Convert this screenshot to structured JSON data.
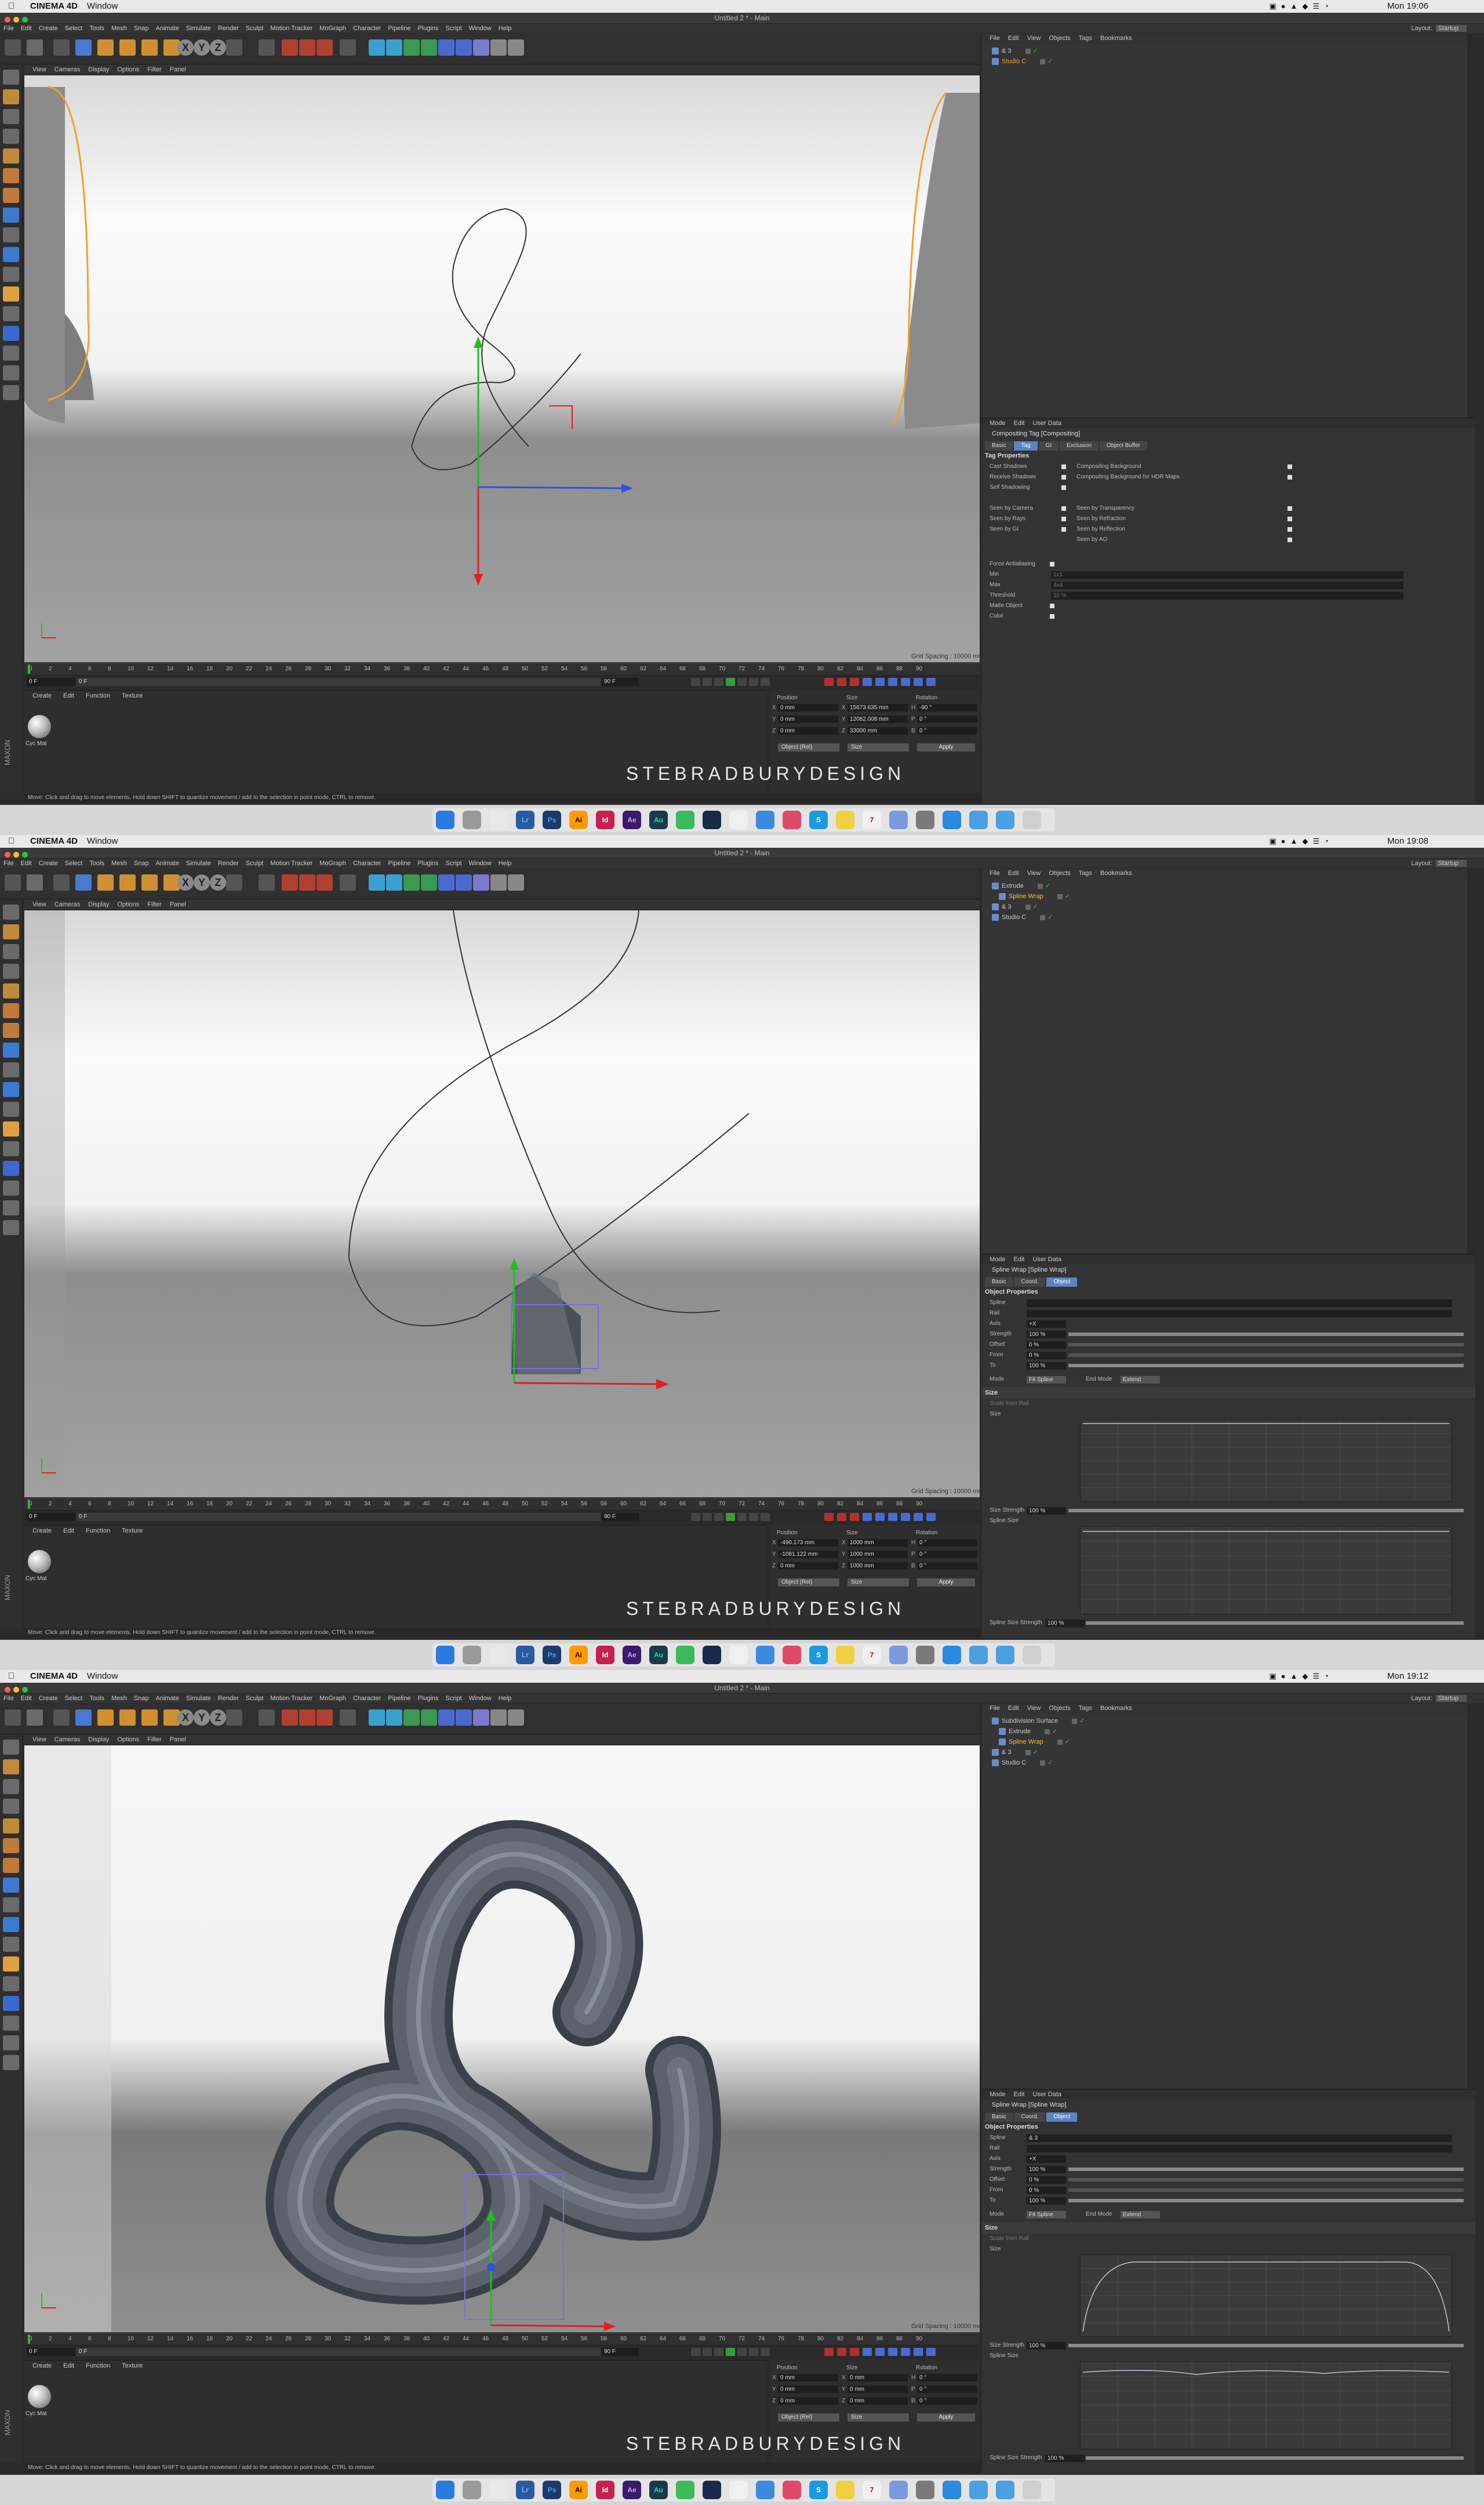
{
  "app": {
    "mac_app_name": "CINEMA 4D",
    "mac_window_menu": "Window",
    "window_title": "Untitled 2 * - Main",
    "watermark": "STEBRADBURYDESIGN",
    "maxon_logo": "MAXON",
    "layout_label": "Layout:",
    "layout_value": "Startup",
    "menu": [
      "File",
      "Edit",
      "Create",
      "Select",
      "Tools",
      "Mesh",
      "Snap",
      "Animate",
      "Simulate",
      "Render",
      "Sculpt",
      "Motion Tracker",
      "MoGraph",
      "Character",
      "Pipeline",
      "Plugins",
      "Script",
      "Window",
      "Help"
    ],
    "viewport_menu": [
      "View",
      "Cameras",
      "Display",
      "Options",
      "Filter",
      "Panel"
    ],
    "object_menu": [
      "File",
      "Edit",
      "View",
      "Objects",
      "Tags",
      "Bookmarks"
    ],
    "attr_menu": [
      "Mode",
      "Edit",
      "User Data"
    ],
    "material_menu": [
      "Create",
      "Edit",
      "Function",
      "Texture"
    ],
    "material_name": "Cyc Mat",
    "coord_headers": {
      "position": "Position",
      "size": "Size",
      "rotation": "Rotation"
    },
    "coord_axis_labels": [
      "X",
      "Y",
      "Z"
    ],
    "rot_labels": [
      "H",
      "P",
      "B"
    ],
    "coord_object_mode": "Object (Rel)",
    "coord_size_mode": "Size",
    "apply_label": "Apply",
    "ruler_ticks": [
      "0",
      "2",
      "4",
      "6",
      "8",
      "10",
      "12",
      "14",
      "16",
      "18",
      "20",
      "22",
      "24",
      "26",
      "28",
      "30",
      "32",
      "34",
      "36",
      "38",
      "40",
      "42",
      "44",
      "46",
      "48",
      "50",
      "52",
      "54",
      "56",
      "58",
      "60",
      "62",
      "64",
      "66",
      "68",
      "70",
      "72",
      "74",
      "76",
      "78",
      "80",
      "82",
      "84",
      "86",
      "88",
      "90"
    ],
    "frame_start": "0 F",
    "frame_end": "90 F",
    "frame_current": "0 F",
    "grid_spacing": "Grid Spacing : 10000 mm",
    "status_text": "Move: Click and drag to move elements. Hold down SHIFT to quantize movement / add to the selection in point mode, CTRL to remove.",
    "colors": {
      "accent": "#5b84c4",
      "orange_outline": "#f0a030",
      "x_axis": "#e02020",
      "y_axis": "#20c020",
      "z_axis": "#3050e0"
    }
  },
  "shots": [
    {
      "clock": "Mon 19:06",
      "objects": [
        {
          "name": "& 3",
          "color": "#c8c8c8"
        },
        {
          "name": "Studio C",
          "color": "#f0a030"
        }
      ],
      "attr": {
        "title": "Compositing Tag [Compositing]",
        "tabs": [
          "Basic",
          "Tag",
          "GI",
          "Exclusion",
          "Object Buffer"
        ],
        "active_tab": "Tag",
        "section": "Tag Properties",
        "left_props": [
          "Cast Shadows",
          "Receive Shadows",
          "Self Shadowing",
          "",
          "Seen by Camera",
          "Seen by Rays",
          "Seen by GI"
        ],
        "right_props": [
          "Compositing Background",
          "Compositing Background for HDR Maps",
          "",
          "",
          "Seen by Transparency",
          "Seen by Refraction",
          "Seen by Reflection",
          "Seen by AO"
        ],
        "extra_props": [
          "Force Antialiasing",
          "Min",
          "Max",
          "Threshold",
          "Matte Object",
          "Color"
        ],
        "extra_values": [
          "",
          "1x1",
          "4x4",
          "10 %",
          "",
          ""
        ]
      },
      "coords": {
        "pos": [
          "0 mm",
          "0 mm",
          "0 mm"
        ],
        "size": [
          "15673.635 mm",
          "12082.008 mm",
          "33000 mm"
        ],
        "rot": [
          "-90 °",
          "0 °",
          "0 °"
        ]
      }
    },
    {
      "clock": "Mon 19:08",
      "objects": [
        {
          "name": "Extrude",
          "color": "#c8c8c8"
        },
        {
          "name": "Spline Wrap",
          "color": "#f0c040"
        },
        {
          "name": "& 3",
          "color": "#c8c8c8"
        },
        {
          "name": "Studio C",
          "color": "#c8c8c8"
        }
      ],
      "attr": {
        "title": "Spline Wrap [Spline Wrap]",
        "tabs": [
          "Basic",
          "Coord.",
          "Object"
        ],
        "active_tab": "Object",
        "section": "Object Properties",
        "props": [
          "Spline",
          "Rail",
          "Axis",
          "Strength",
          "Offset",
          "From",
          "To"
        ],
        "values": [
          "",
          "",
          "+X",
          "100 %",
          "0 %",
          "0 %",
          "100 %"
        ],
        "mode_label": "Mode",
        "mode_value": "Fit Spline",
        "end_mode_label": "End Mode",
        "end_mode_value": "Extend",
        "size_section": "Size",
        "scale_from_rail": "Scale from Rail",
        "size_label": "Size",
        "size_strength": "Size Strength",
        "size_strength_value": "100 %",
        "spline_size": "Spline Size",
        "spline_size_strength": "Spline Size Strength",
        "spline_size_strength_value": "100 %"
      },
      "coords": {
        "pos": [
          "-490.173 mm",
          "-1081.122 mm",
          "0 mm"
        ],
        "size": [
          "1000 mm",
          "1000 mm",
          "1000 mm"
        ],
        "rot": [
          "0 °",
          "0 °",
          "0 °"
        ]
      }
    },
    {
      "clock": "Mon 19:12",
      "objects": [
        {
          "name": "Subdivision Surface",
          "color": "#c8c8c8"
        },
        {
          "name": "Extrude",
          "color": "#c8c8c8"
        },
        {
          "name": "Spline Wrap",
          "color": "#f0c040"
        },
        {
          "name": "& 3",
          "color": "#c8c8c8"
        },
        {
          "name": "Studio C",
          "color": "#c8c8c8"
        }
      ],
      "attr": {
        "title": "Spline Wrap [Spline Wrap]",
        "tabs": [
          "Basic",
          "Coord.",
          "Object"
        ],
        "active_tab": "Object",
        "section": "Object Properties",
        "props": [
          "Spline",
          "Rail",
          "Axis",
          "Strength",
          "Offset",
          "From",
          "To"
        ],
        "values": [
          "& 3",
          "",
          "+X",
          "100 %",
          "0 %",
          "0 %",
          "100 %"
        ],
        "mode_label": "Mode",
        "mode_value": "Fit Spline",
        "end_mode_label": "End Mode",
        "end_mode_value": "Extend",
        "size_section": "Size",
        "scale_from_rail": "Scale from Rail",
        "size_label": "Size",
        "size_strength": "Size Strength",
        "size_strength_value": "100 %",
        "spline_size": "Spline Size",
        "spline_size_strength": "Spline Size Strength",
        "spline_size_strength_value": "100 %"
      },
      "coords": {
        "pos": [
          "0 mm",
          "0 mm",
          "0 mm"
        ],
        "size": [
          "0 mm",
          "0 mm",
          "0 mm"
        ],
        "rot": [
          "0 °",
          "0 °",
          "0 °"
        ]
      }
    }
  ],
  "dock_apps": [
    "Finder",
    "Launchpad",
    "Chrome",
    "Lr",
    "Ps",
    "Ai",
    "Id",
    "Ae",
    "Au",
    "Messages",
    "Cinema 4D",
    "Photos",
    "Mail",
    "Music",
    "Skype",
    "Notes",
    "Calendar",
    "Preview",
    "System Preferences",
    "App Store",
    "Folder",
    "Downloads",
    "Trash"
  ]
}
